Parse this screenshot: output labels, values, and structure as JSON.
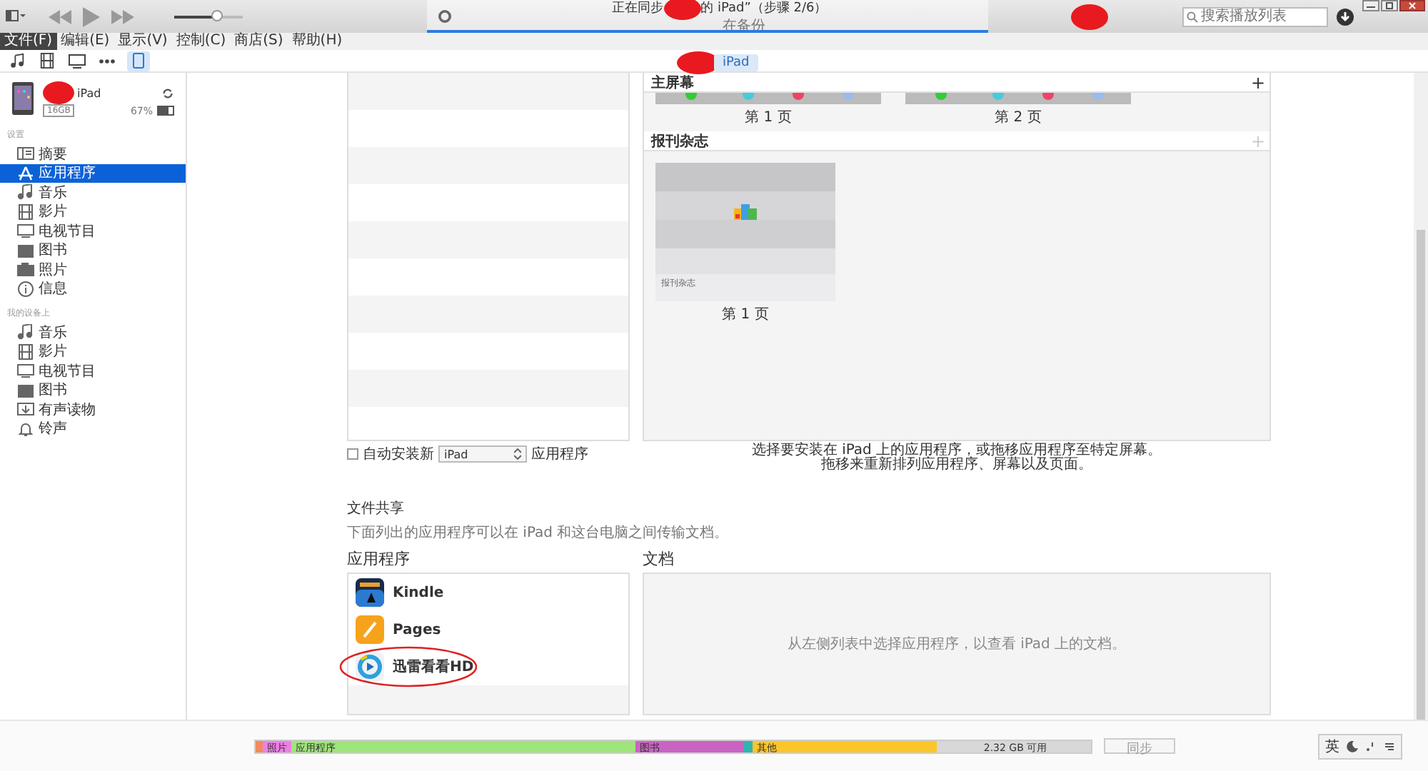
{
  "player": {
    "volume": {
      "level": 0.62
    },
    "now_syncing": {
      "title_start": "正在同步",
      "title_end": "的 iPad”（步骤 2/6）",
      "subtitle": "在备份"
    },
    "search": {
      "placeholder": "搜索播放列表"
    }
  },
  "menu": [
    {
      "label": "文件(F)",
      "selected": true
    },
    {
      "label": "编辑(E)",
      "selected": false
    },
    {
      "label": "显示(V)",
      "selected": false
    },
    {
      "label": "控制(C)",
      "selected": false
    },
    {
      "label": "商店(S)",
      "selected": false
    },
    {
      "label": "帮助(H)",
      "selected": false
    }
  ],
  "media_buttons": [
    {
      "kind": "music",
      "selected": false
    },
    {
      "kind": "movies",
      "selected": false
    },
    {
      "kind": "tv",
      "selected": false
    },
    {
      "kind": "more",
      "selected": false
    },
    {
      "kind": "ipad",
      "selected": true
    }
  ],
  "device_tab": {
    "label": "iPad"
  },
  "device": {
    "name": "iPad",
    "capacity": "16GB",
    "battery": "67%"
  },
  "sidebar": [
    {
      "heading": "设置",
      "items": [
        {
          "label": "摘要",
          "kind": "summary",
          "selected": false
        },
        {
          "label": "应用程序",
          "kind": "apps",
          "selected": true
        },
        {
          "label": "音乐",
          "kind": "music",
          "selected": false
        },
        {
          "label": "影片",
          "kind": "movies",
          "selected": false
        },
        {
          "label": "电视节目",
          "kind": "tv",
          "selected": false
        },
        {
          "label": "图书",
          "kind": "books",
          "selected": false
        },
        {
          "label": "照片",
          "kind": "photos",
          "selected": false
        },
        {
          "label": "信息",
          "kind": "info",
          "selected": false
        }
      ]
    },
    {
      "heading": "我的设备上",
      "items": [
        {
          "label": "音乐",
          "kind": "music",
          "selected": false
        },
        {
          "label": "影片",
          "kind": "movies",
          "selected": false
        },
        {
          "label": "电视节目",
          "kind": "tv",
          "selected": false
        },
        {
          "label": "图书",
          "kind": "books",
          "selected": false
        },
        {
          "label": "有声读物",
          "kind": "audiobooks",
          "selected": false
        },
        {
          "label": "铃声",
          "kind": "tones",
          "selected": false
        }
      ]
    }
  ],
  "screens": [
    {
      "title": "主屏幕",
      "pages": [
        "第 1 页",
        "第 2 页"
      ],
      "add_label": "+",
      "add_enabled": true
    },
    {
      "title": "报刊杂志",
      "pages": [
        "第 1 页"
      ],
      "add_label": "+",
      "add_enabled": false,
      "thumb_caption": "报刊杂志"
    }
  ],
  "auto_install": {
    "checked": false,
    "label_before": "自动安装新",
    "select_value": "iPad",
    "label_after": "应用程序"
  },
  "screens_hint": [
    "选择要安装在 iPad 上的应用程序，或拖移应用程序至特定屏幕。",
    "拖移来重新排列应用程序、屏幕以及页面。"
  ],
  "file_sharing": {
    "title": "文件共享",
    "description": "下面列出的应用程序可以在 iPad 和这台电脑之间传输文档。",
    "apps_heading": "应用程序",
    "docs_heading": "文档",
    "docs_hint": "从左侧列表中选择应用程序，以查看 iPad 上的文档。",
    "apps": [
      {
        "name": "Kindle",
        "kind": "kindle",
        "circled": false
      },
      {
        "name": "Pages",
        "kind": "pages",
        "circled": false
      },
      {
        "name": "迅雷看看HD",
        "kind": "xunlei",
        "circled": true
      }
    ]
  },
  "storage": [
    {
      "color": "#f08c5a"
    },
    {
      "label": "照片",
      "color": "#ee7fe6"
    },
    {
      "label": "应用程序",
      "color": "#9ee57a"
    },
    {
      "label": "图书",
      "color": "#c963c2"
    },
    {
      "color": "#2fb5b0"
    },
    {
      "label": "其他",
      "color": "#fcc52a"
    },
    {
      "label": "2.32 GB 可用",
      "color": "#d8d8d8"
    }
  ],
  "sync_button": "同步",
  "ime": {
    "label": "英"
  }
}
